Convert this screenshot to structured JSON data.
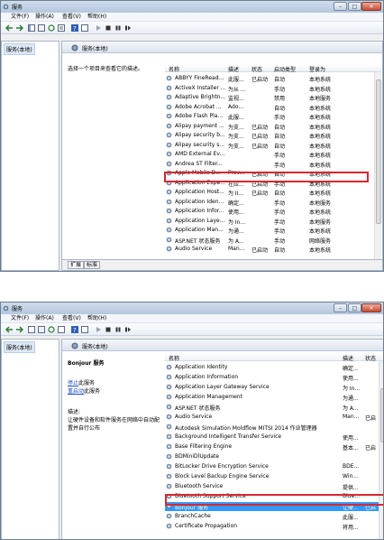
{
  "window1": {
    "title": "服务",
    "menu": [
      "文件(F)",
      "操作(A)",
      "查看(V)",
      "帮助(H)"
    ],
    "tree_item": "服务(本地)",
    "panel_header": "服务(本地)",
    "description": "选择一个项目来查看它的描述。",
    "columns": [
      "名称",
      "描述",
      "状态",
      "启动类型",
      "登录为"
    ],
    "rows": [
      [
        "ABBYY FineRead...",
        "此服...",
        "已启动",
        "自动",
        "本地系统"
      ],
      [
        "ActiveX Installer ...",
        "为从 ...",
        "",
        "手动",
        "本地系统"
      ],
      [
        "Adaptive Brightn...",
        "监视...",
        "",
        "禁用",
        "本地服务"
      ],
      [
        "Adobe Acrobat ...",
        "Ado...",
        "",
        "自动",
        "本地系统"
      ],
      [
        "Adobe Flash Pla...",
        "此服...",
        "",
        "手动",
        "本地系统"
      ],
      [
        "Alipay payment ...",
        "为支...",
        "已启动",
        "自动",
        "本地系统"
      ],
      [
        "Alipay security b...",
        "为支...",
        "已启动",
        "自动",
        "本地系统"
      ],
      [
        "Alipay security s...",
        "为支...",
        "已启动",
        "自动",
        "本地系统"
      ],
      [
        "AMD External Ev...",
        "",
        "",
        "手动",
        "本地系统"
      ],
      [
        "Andrea ST Filter...",
        "",
        "",
        "手动",
        "本地系统"
      ],
      [
        "Apple Mobile D...",
        "Prov...",
        "已启动",
        "自动",
        "本地系统"
      ],
      [
        "Application Expe...",
        "在应...",
        "已启动",
        "手动",
        "本地系统"
      ],
      [
        "Application Host...",
        "为 II...",
        "已启动",
        "自动",
        "本地系统"
      ],
      [
        "Application Iden...",
        "确定...",
        "",
        "手动",
        "本地服务"
      ],
      [
        "Application Infor...",
        "使用...",
        "",
        "手动",
        "本地系统"
      ],
      [
        "Application Laye...",
        "为 In...",
        "",
        "手动",
        "本地服务"
      ],
      [
        "Application Man...",
        "为通...",
        "",
        "手动",
        "本地系统"
      ],
      [
        "ASP.NET 状态服务",
        "为 A...",
        "",
        "手动",
        "网络服务"
      ],
      [
        "Audio Service",
        "Man...",
        "已启动",
        "自动",
        "本地系统"
      ]
    ],
    "tabs": [
      "扩展",
      "标准"
    ]
  },
  "window2": {
    "title": "服务",
    "menu": [
      "文件(F)",
      "操作(A)",
      "查看(V)",
      "帮助(H)"
    ],
    "tree_item": "服务(本地)",
    "panel_header": "服务(本地)",
    "service_title": "Bonjour 服务",
    "link_stop": "停止",
    "link_stop_suffix": "此服务",
    "link_restart": "重启动",
    "link_restart_suffix": "此服务",
    "desc_label": "描述:",
    "desc_text": "让硬件设备和软件服务在网络中自动配置并自行公布",
    "columns": [
      "名称",
      "描述",
      "状态"
    ],
    "rows": [
      [
        "Application Identity",
        "确定...",
        ""
      ],
      [
        "Application Information",
        "使用...",
        ""
      ],
      [
        "Application Layer Gateway Service",
        "为 In...",
        ""
      ],
      [
        "Application Management",
        "为通...",
        ""
      ],
      [
        "ASP.NET 状态服务",
        "为 A...",
        ""
      ],
      [
        "Audio Service",
        "Man...",
        "已启"
      ],
      [
        "Autodesk Simulation Moldflow MITSI 2014 作业管理器",
        "",
        ""
      ],
      [
        "Background Intelligent Transfer Service",
        "使用...",
        ""
      ],
      [
        "Base Filtering Engine",
        "基本...",
        "已启"
      ],
      [
        "BDMiniDlUpdate",
        "",
        ""
      ],
      [
        "BitLocker Drive Encryption Service",
        "BDE...",
        ""
      ],
      [
        "Block Level Backup Engine Service",
        "Win...",
        ""
      ],
      [
        "Bluetooth Service",
        "提供...",
        ""
      ],
      [
        "Bluetooth Support Service",
        "Blue...",
        ""
      ],
      [
        "Bonjour 服务",
        "让硬...",
        "已启"
      ],
      [
        "BranchCache",
        "此服...",
        ""
      ],
      [
        "Certificate Propagation",
        "将用...",
        ""
      ]
    ]
  },
  "colors": {
    "highlight_box": "#d7282f",
    "selected_row": "#3399ff",
    "link": "#1a4fbf"
  }
}
